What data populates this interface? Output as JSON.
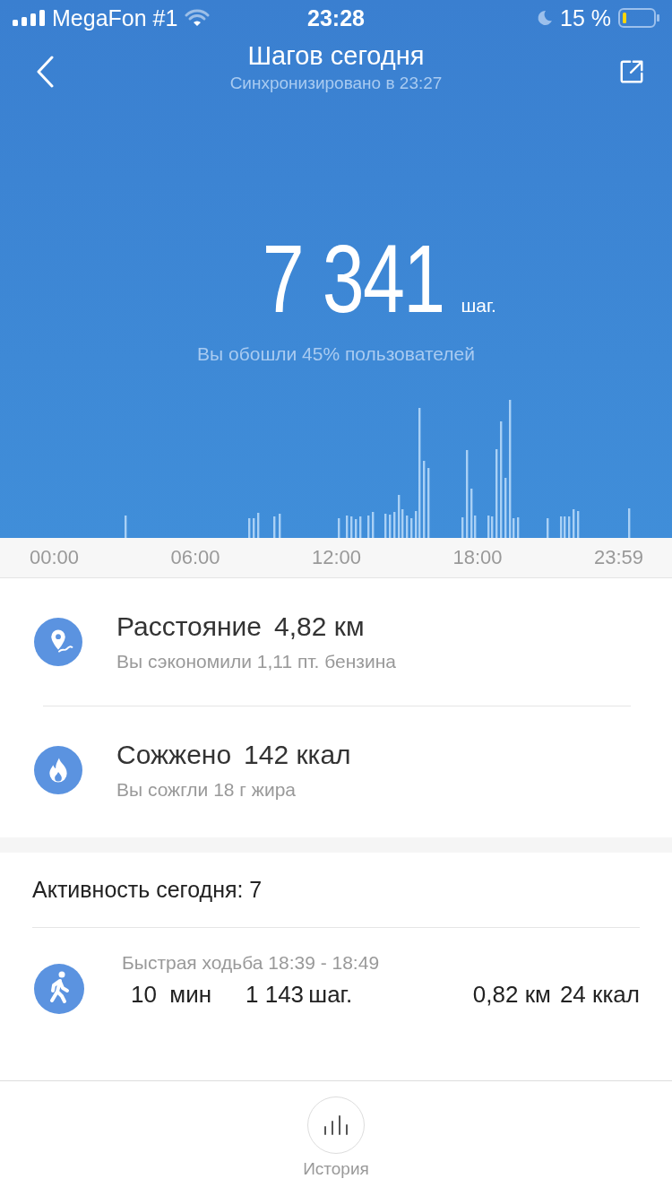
{
  "status_bar": {
    "carrier": "MegaFon #1",
    "time": "23:28",
    "battery": "15 %"
  },
  "header": {
    "title": "Шагов сегодня",
    "subtitle": "Синхронизировано в 23:27"
  },
  "steps": {
    "value": "7 341",
    "unit": "шаг.",
    "comparison": "Вы обошли 45% пользователей"
  },
  "chart_axis": [
    "00:00",
    "06:00",
    "12:00",
    "18:00",
    "23:59"
  ],
  "stats": [
    {
      "kind": "distance",
      "label": "Расстояние",
      "value": "4,82 км",
      "note": "Вы сэкономили 1,11 пт. бензина"
    },
    {
      "kind": "calories",
      "label": "Сожжено",
      "value": "142 ккал",
      "note": "Вы сожгли 18 г жира"
    }
  ],
  "activity": {
    "title": "Активность сегодня: 7",
    "items": [
      {
        "kind": "walk",
        "name": "Быстрая ходьба 18:39 - 18:49",
        "duration": "10  мин",
        "steps": "1 143",
        "steps_unit": "шаг.",
        "distance": "0,82 км",
        "calories": "24 ккал"
      }
    ]
  },
  "bottom_nav": {
    "label": "История"
  }
}
